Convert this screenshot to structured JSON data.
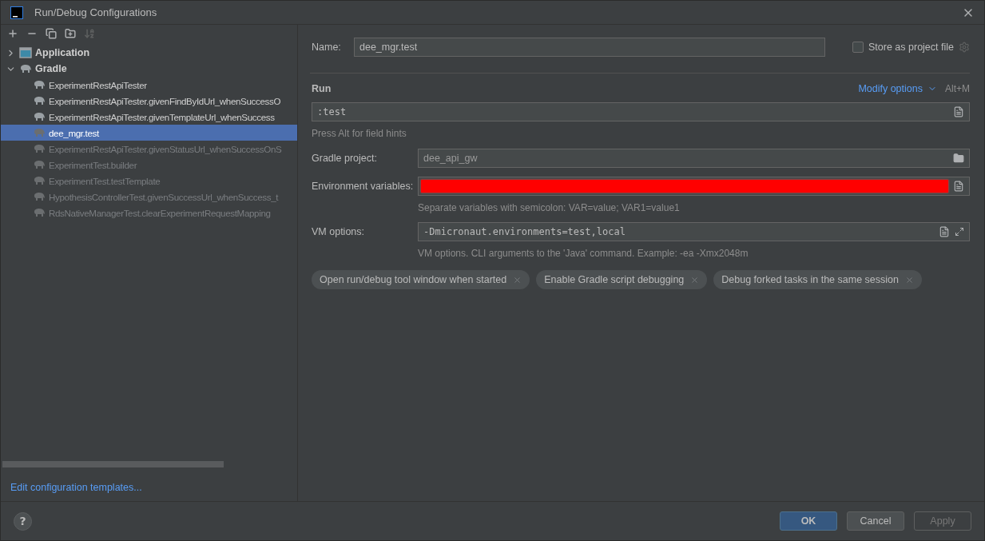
{
  "window": {
    "title": "Run/Debug Configurations"
  },
  "toolbar": [
    {
      "kind": "add",
      "disabled": false
    },
    {
      "kind": "remove",
      "disabled": false
    },
    {
      "kind": "copy",
      "disabled": false
    },
    {
      "kind": "folder",
      "disabled": false
    },
    {
      "kind": "sort",
      "disabled": true
    }
  ],
  "tree": [
    {
      "label": "Application",
      "kind": "application",
      "expanded": false
    },
    {
      "label": "Gradle",
      "kind": "gradle",
      "expanded": true,
      "children": [
        {
          "label": "ExperimentRestApiTester",
          "selected": false,
          "dimmed": false
        },
        {
          "label": "ExperimentRestApiTester.givenFindByIdUrl_whenSuccessO",
          "selected": false,
          "dimmed": false
        },
        {
          "label": "ExperimentRestApiTester.givenTemplateUrl_whenSuccess",
          "selected": false,
          "dimmed": false
        },
        {
          "label": "dee_mgr.test",
          "selected": true,
          "dimmed": false
        },
        {
          "label": "ExperimentRestApiTester.givenStatusUrl_whenSuccessOnS",
          "selected": false,
          "dimmed": true
        },
        {
          "label": "ExperimentTest.builder",
          "selected": false,
          "dimmed": true
        },
        {
          "label": "ExperimentTest.testTemplate",
          "selected": false,
          "dimmed": true
        },
        {
          "label": "HypothesisControllerTest.givenSuccessUrl_whenSuccess_t",
          "selected": false,
          "dimmed": true
        },
        {
          "label": "RdsNativeManagerTest.clearExperimentRequestMapping",
          "selected": false,
          "dimmed": true
        }
      ]
    }
  ],
  "templates_link": "Edit configuration templates...",
  "name": {
    "label": "Name:",
    "value": "dee_mgr.test"
  },
  "store_as_project_file": {
    "label": "Store as project file",
    "checked": false
  },
  "run": {
    "title": "Run",
    "modify_options": "Modify options",
    "shortcut": "Alt+M",
    "task": ":test",
    "hint": "Press Alt for field hints"
  },
  "fields": [
    {
      "label": "Gradle project:",
      "kind": "project",
      "value": "dee_api_gw"
    },
    {
      "label": "Environment variables:",
      "kind": "env",
      "redacted": true,
      "hint": "Separate variables with semicolon: VAR=value; VAR1=value1"
    },
    {
      "label": "VM options:",
      "kind": "vm",
      "value": "-Dmicronaut.environments=test,local",
      "hint": "VM options. CLI arguments to the 'Java' command. Example: -ea -Xmx2048m"
    }
  ],
  "chips": [
    {
      "label": "Open run/debug tool window when started"
    },
    {
      "label": "Enable Gradle script debugging"
    },
    {
      "label": "Debug forked tasks in the same session"
    }
  ],
  "help": "?",
  "buttons": [
    {
      "label": "OK",
      "kind": "primary",
      "disabled": false
    },
    {
      "label": "Cancel",
      "kind": "secondary",
      "disabled": false
    },
    {
      "label": "Apply",
      "kind": "secondary",
      "disabled": true
    }
  ]
}
